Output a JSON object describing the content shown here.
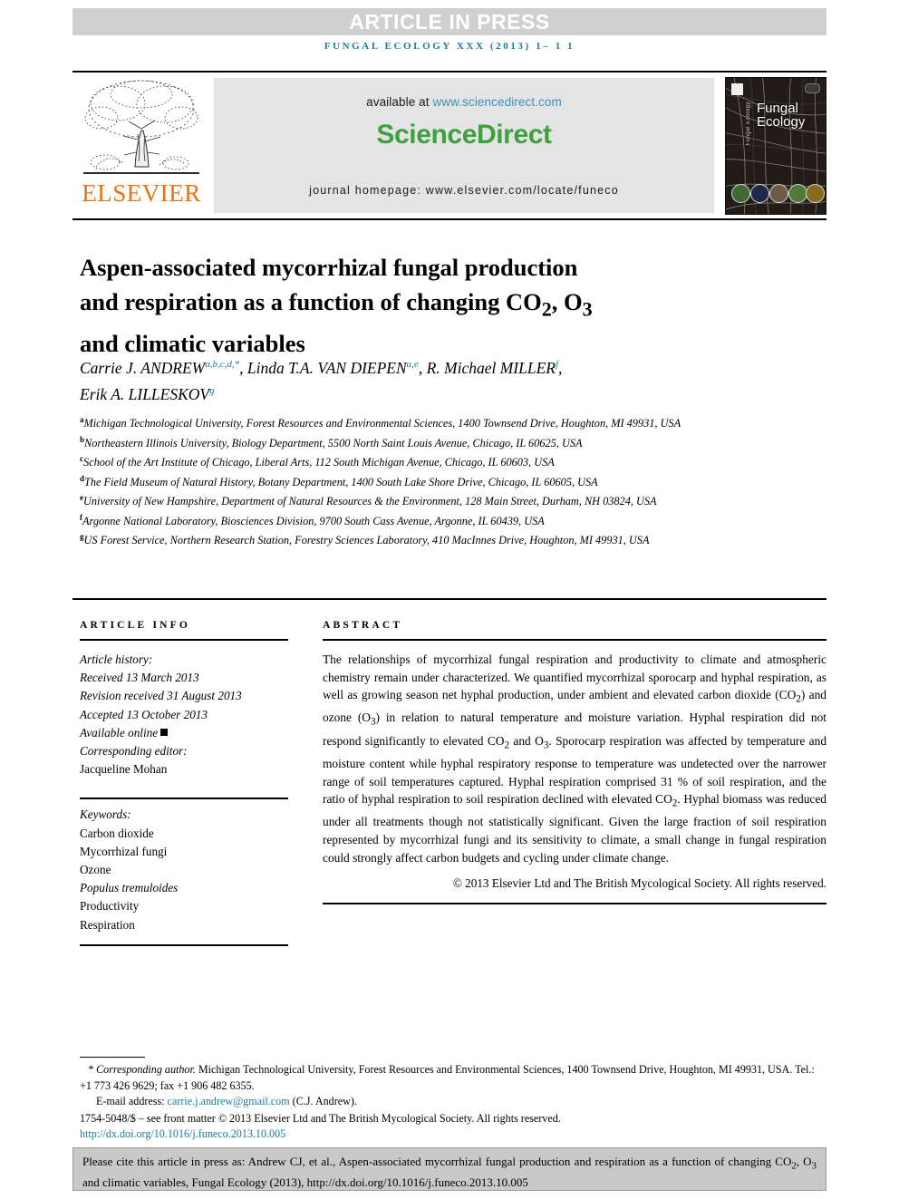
{
  "banner": {
    "article_in_press": "ARTICLE IN PRESS",
    "running_head": "FUNGAL ECOLOGY XXX (2013) 1– 1 1"
  },
  "masthead": {
    "publisher_name": "ELSEVIER",
    "available_at_prefix": "available at ",
    "available_at_url": "www.sciencedirect.com",
    "sciencedirect_logo": "ScienceDirect",
    "journal_homepage": "journal homepage: www.elsevier.com/locate/funeco",
    "cover": {
      "title_line1": "Fungal",
      "title_line2": "Ecology",
      "spine_text": "Fungal Ecology"
    }
  },
  "article": {
    "title_line1": "Aspen-associated mycorrhizal fungal production",
    "title_line2_a": "and respiration as a function of changing CO",
    "title_line2_sub1": "2",
    "title_line2_b": ", O",
    "title_line2_sub2": "3",
    "title_line3": "and climatic variables",
    "authors": [
      {
        "name": "Carrie J. ANDREW",
        "sup": "a,b,c,d,*",
        "sep": ", "
      },
      {
        "name": "Linda T.A. VAN DIEPEN",
        "sup": "a,e",
        "sep": ", "
      },
      {
        "name": "R. Michael MILLER",
        "sup": "f",
        "sep": ", "
      },
      {
        "name": "Erik A. LILLESKOV",
        "sup": "g",
        "sep": ""
      }
    ],
    "affiliations": [
      {
        "key": "a",
        "text": "Michigan Technological University, Forest Resources and Environmental Sciences, 1400 Townsend Drive, Houghton, MI 49931, USA"
      },
      {
        "key": "b",
        "text": "Northeastern Illinois University, Biology Department, 5500 North Saint Louis Avenue, Chicago, IL 60625, USA"
      },
      {
        "key": "c",
        "text": "School of the Art Institute of Chicago, Liberal Arts, 112 South Michigan Avenue, Chicago, IL 60603, USA"
      },
      {
        "key": "d",
        "text": "The Field Museum of Natural History, Botany Department, 1400 South Lake Shore Drive, Chicago, IL 60605, USA"
      },
      {
        "key": "e",
        "text": "University of New Hampshire, Department of Natural Resources & the Environment, 128 Main Street, Durham, NH 03824, USA"
      },
      {
        "key": "f",
        "text": "Argonne National Laboratory, Biosciences Division, 9700 South Cass Avenue, Argonne, IL 60439, USA"
      },
      {
        "key": "g",
        "text": "US Forest Service, Northern Research Station, Forestry Sciences Laboratory, 410 MacInnes Drive, Houghton, MI 49931, USA"
      }
    ]
  },
  "article_info": {
    "heading": "ARTICLE INFO",
    "history_label": "Article history:",
    "received": "Received 13 March 2013",
    "revision_received": "Revision received 31 August 2013",
    "accepted": "Accepted 13 October 2013",
    "available_online": "Available online",
    "corresponding_editor_label": "Corresponding editor:",
    "corresponding_editor": "Jacqueline Mohan",
    "keywords_label": "Keywords:",
    "keywords": [
      "Carbon dioxide",
      "Mycorrhizal fungi",
      "Ozone",
      "Populus tremuloides",
      "Productivity",
      "Respiration"
    ]
  },
  "abstract": {
    "heading": "ABSTRACT",
    "paragraph_1": "The relationships of mycorrhizal fungal respiration and productivity to climate and atmospheric chemistry remain under characterized. We quantified mycorrhizal sporocarp and hyphal respiration, as well as growing season net hyphal production, under ambient and elevated carbon dioxide (CO",
    "sub_co2_a": "2",
    "paragraph_2": ") and ozone (O",
    "sub_o3_a": "3",
    "paragraph_3": ") in relation to natural temperature and moisture variation. Hyphal respiration did not respond significantly to elevated CO",
    "sub_co2_b": "2",
    "paragraph_4": " and O",
    "sub_o3_b": "3",
    "paragraph_5": ". Sporocarp respiration was affected by temperature and moisture content while hyphal respiratory response to temperature was undetected over the narrower range of soil temperatures captured. Hyphal respiration comprised 31 % of soil respiration, and the ratio of hyphal respiration to soil respiration declined with elevated CO",
    "sub_co2_c": "2",
    "paragraph_6": ". Hyphal biomass was reduced under all treatments though not statistically significant. Given the large fraction of soil respiration represented by mycorrhizal fungi and its sensitivity to climate, a small change in fungal respiration could strongly affect carbon budgets and cycling under climate change.",
    "copyright": "© 2013 Elsevier Ltd and The British Mycological Society. All rights reserved."
  },
  "footnotes": {
    "corresponding_marker": "*",
    "corresponding_label": "Corresponding author.",
    "corresponding_address": " Michigan Technological University, Forest Resources and Environmental Sciences, 1400 Townsend Drive, Houghton, MI 49931, USA. Tel.: +1 773 426 9629; fax +1 906 482 6355.",
    "email_label": "E-mail address:",
    "email": "carrie.j.andrew@gmail.com",
    "email_owner": "(C.J. Andrew).",
    "front_matter": "1754-5048/$ – see front matter © 2013 Elsevier Ltd and The British Mycological Society. All rights reserved.",
    "doi": "http://dx.doi.org/10.1016/j.funeco.2013.10.005"
  },
  "cite_box": {
    "text_a": "Please cite this article in press as: Andrew CJ, et al., Aspen-associated mycorrhizal fungal production and respiration as a function of changing CO",
    "sub_1": "2",
    "text_b": ", O",
    "sub_2": "3",
    "text_c": " and climatic variables, Fungal Ecology (2013), http://dx.doi.org/10.1016/j.funeco.2013.10.005"
  },
  "colors": {
    "accent_teal": "#1a7ba4",
    "sciencedirect_green": "#40a040",
    "elsevier_orange": "#ec7211",
    "banner_gray": "#d0d0d0",
    "band_gray": "#e4e4e4",
    "cite_gray": "#c9c9c9"
  }
}
